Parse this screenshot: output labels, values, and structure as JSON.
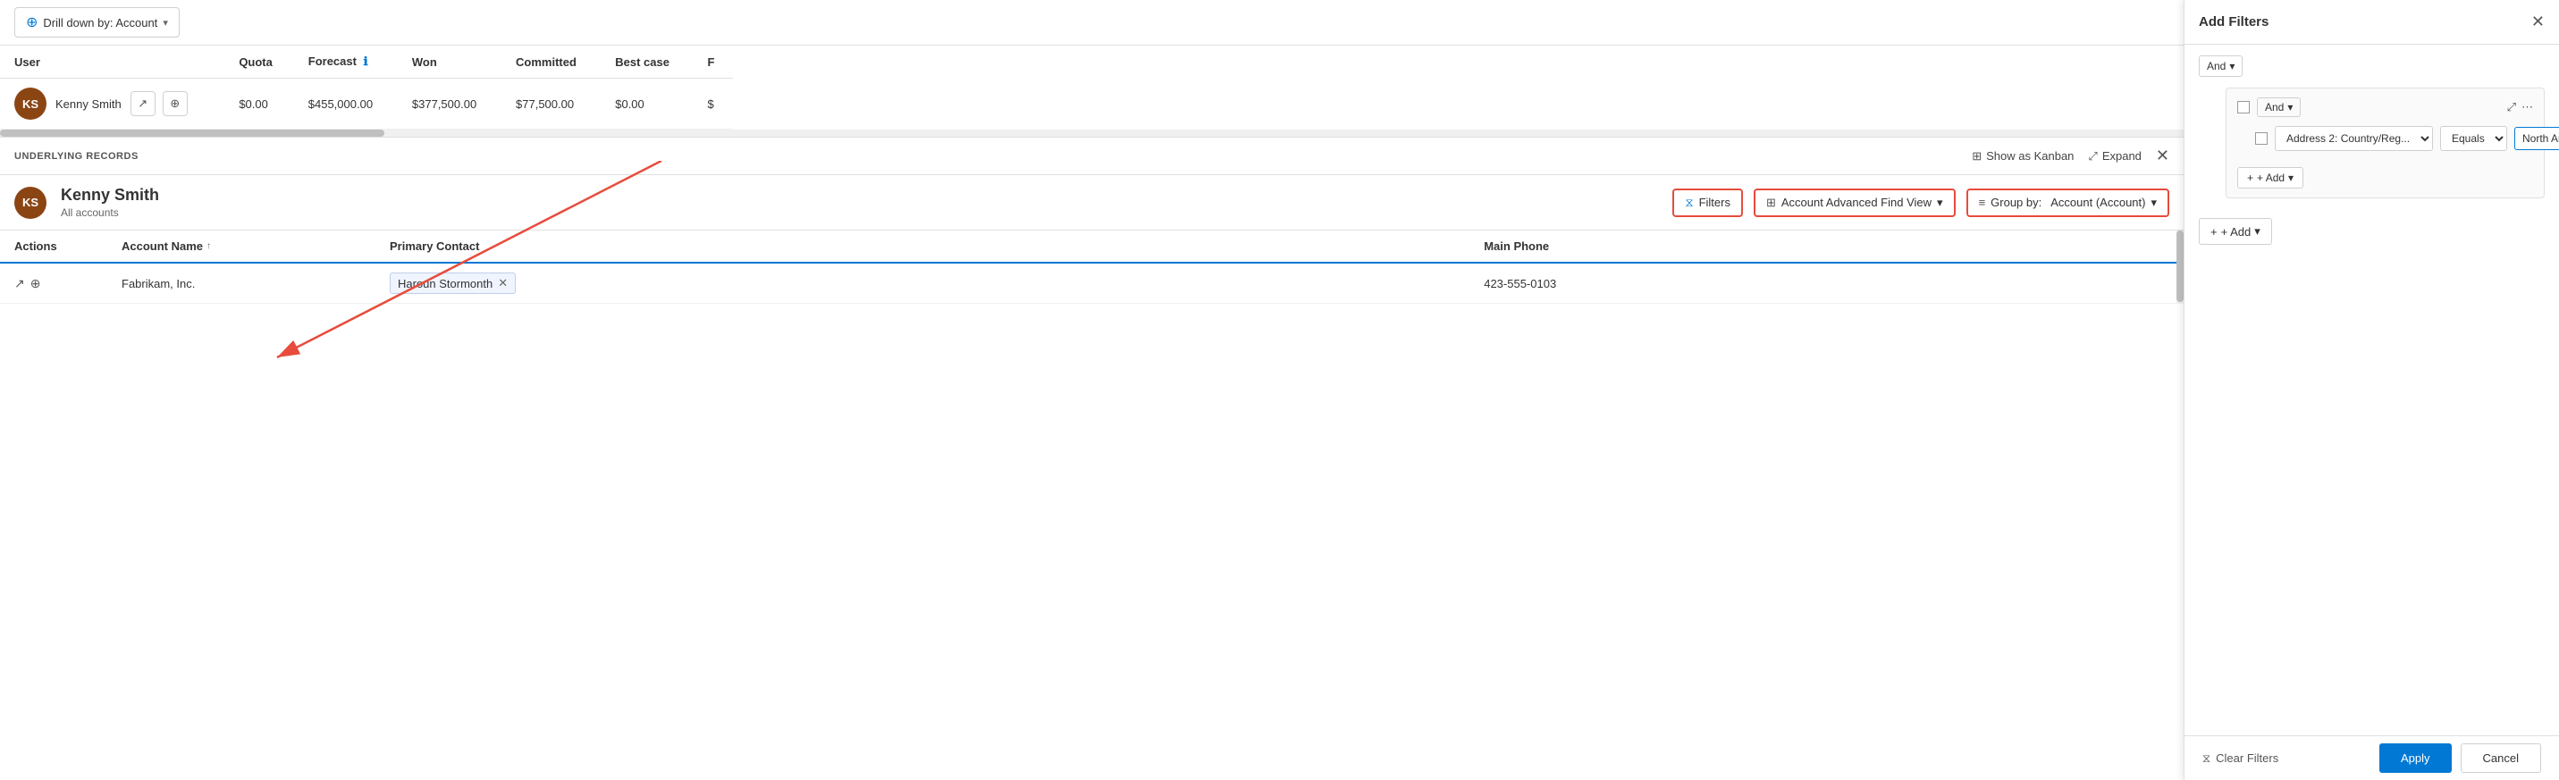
{
  "drillDown": {
    "label": "Drill down by: Account",
    "chevron": "▾"
  },
  "forecastTable": {
    "columns": [
      "User",
      "Quota",
      "Forecast",
      "Won",
      "Committed",
      "Best case",
      "F"
    ],
    "rows": [
      {
        "initials": "KS",
        "name": "Kenny Smith",
        "quota": "$0.00",
        "forecast": "$455,000.00",
        "won": "$377,500.00",
        "committed": "$77,500.00",
        "bestCase": "$0.00",
        "f": "$"
      }
    ]
  },
  "underlyingRecords": {
    "title": "UNDERLYING RECORDS",
    "showAsKanban": "Show as Kanban",
    "expand": "Expand"
  },
  "ksSection": {
    "initials": "KS",
    "name": "Kenny Smith",
    "sub": "All accounts",
    "filterLabel": "Filters",
    "viewLabel": "Account Advanced Find View",
    "groupLabel": "Group by:",
    "groupValue": "Account (Account)"
  },
  "dataTable": {
    "columns": [
      {
        "key": "actions",
        "label": "Actions"
      },
      {
        "key": "accountName",
        "label": "Account Name",
        "sortable": true,
        "sortDir": "asc"
      },
      {
        "key": "primaryContact",
        "label": "Primary Contact"
      },
      {
        "key": "mainPhone",
        "label": "Main Phone"
      }
    ],
    "rows": [
      {
        "accountName": "Fabrikam, Inc.",
        "primaryContact": "Haroun Stormonth",
        "mainPhone": "423-555-0103"
      }
    ]
  },
  "rightPanel": {
    "title": "Add Filters",
    "closeIcon": "✕",
    "topAndLabel": "And",
    "topAndChevron": "▾",
    "filterGroup": {
      "andLabel": "And",
      "andChevron": "▾",
      "expandIcon": "⤢",
      "moreIcon": "⋯",
      "field": "Address 2: Country/Reg...",
      "operator": "Equals",
      "value": "North America",
      "addLabel": "+ Add",
      "addChevron": "▾"
    },
    "addMainLabel": "+ Add",
    "addMainChevron": "▾"
  },
  "bottomBar": {
    "clearFiltersIcon": "⧖",
    "clearFiltersLabel": "Clear  Filters",
    "applyLabel": "Apply",
    "cancelLabel": "Cancel"
  }
}
